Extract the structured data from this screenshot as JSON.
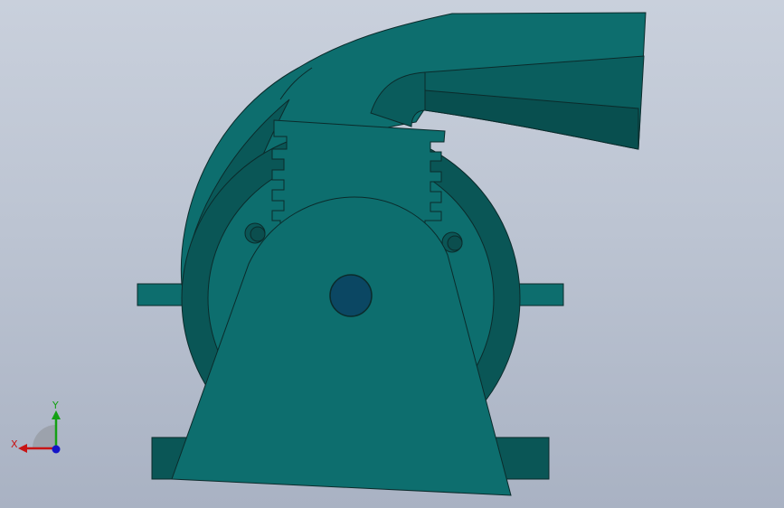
{
  "colors": {
    "background_top": "#c9d0dc",
    "background_bottom": "#a9b2c3",
    "part_primary": "#0d6e6e",
    "part_dark": "#0a5656",
    "part_darker": "#084848",
    "edge": "#0b2b2b",
    "hub": "#0b4763",
    "axis_x": "#c81414",
    "axis_y": "#14a014",
    "axis_z": "#1414c8"
  },
  "model": {
    "parts": [
      "volute-housing",
      "outlet-duct",
      "motor-mount-plate",
      "base-support",
      "flange",
      "shaft-hub"
    ]
  },
  "triad": {
    "x_label": "X",
    "y_label": "Y"
  }
}
